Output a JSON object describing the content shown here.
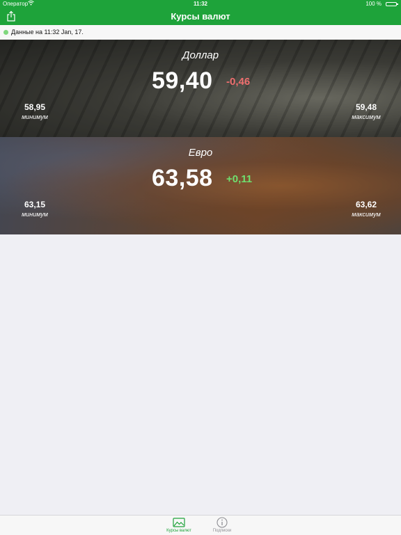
{
  "status_bar": {
    "carrier": "Оператор",
    "time": "11:32",
    "battery": "100 %"
  },
  "nav": {
    "title": "Курсы валют",
    "share_icon": "share-icon"
  },
  "update": {
    "text": "Данные на 11:32 Jan, 17."
  },
  "rates": [
    {
      "name": "Доллар",
      "value": "59,40",
      "change": "-0,46",
      "min_value": "58,95",
      "min_label": "минимум",
      "max_value": "59,48",
      "max_label": "максимум"
    },
    {
      "name": "Евро",
      "value": "63,58",
      "change": "+0,11",
      "min_value": "63,15",
      "min_label": "минимум",
      "max_value": "63,62",
      "max_label": "максимум"
    }
  ],
  "tabs": [
    {
      "label": "Курсы валют",
      "icon": "chart-image-icon",
      "active": true
    },
    {
      "label": "Подписки",
      "icon": "info-icon",
      "active": false
    }
  ],
  "colors": {
    "accent": "#1ea33a",
    "negative": "#ef6f6f",
    "positive": "#6fe06f",
    "status_dot": "#7fd77d"
  }
}
